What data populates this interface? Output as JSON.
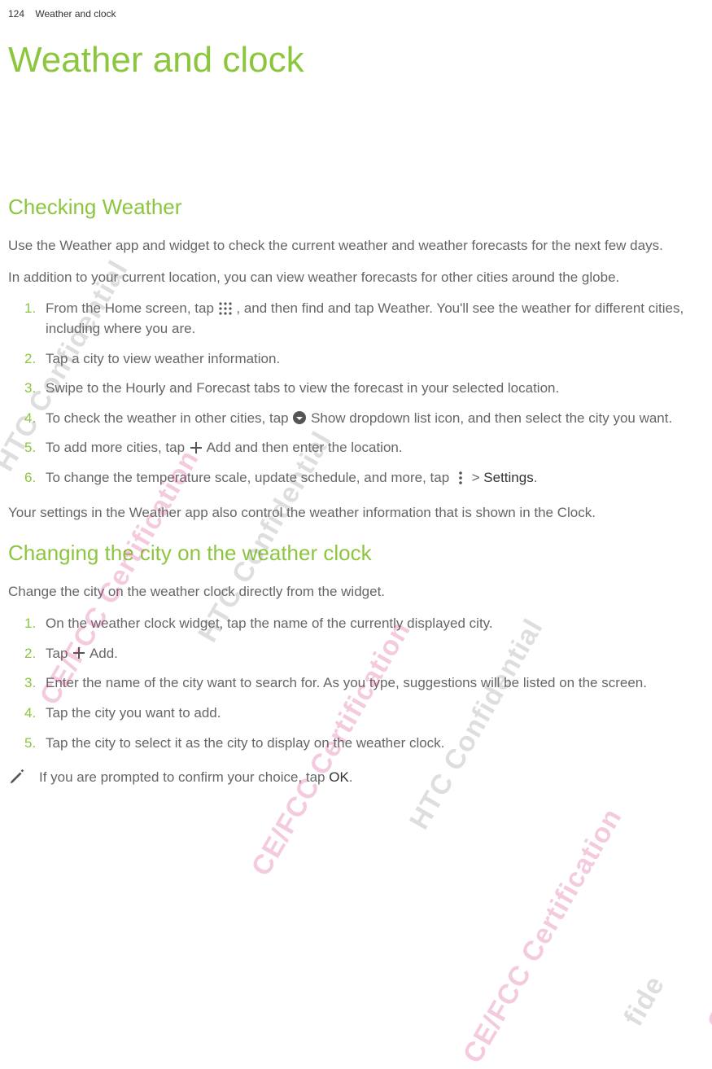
{
  "header": {
    "page_number": "124",
    "running_title": "Weather and clock"
  },
  "title": "Weather and clock",
  "section1": {
    "heading": "Checking Weather",
    "para1": "Use the Weather app and widget to check the current weather and weather forecasts for the next few days.",
    "para2": " In addition to your current location, you can view weather forecasts for other cities around the globe.",
    "steps": {
      "s1a": " From the Home screen, tap ",
      "s1b": ", and then find and tap Weather. You'll see the weather for different cities, including where you are.",
      "s2": "Tap a city to view weather information.",
      "s3": "Swipe to the Hourly and Forecast  tabs to view the forecast in your selected location.",
      "s4a": "To check the weather in other cities, tap ",
      "s4b": "Show dropdown list icon, and then select the city you want.",
      "s5a": "To add more cities, tap ",
      "s5b": "Add and then enter the location.",
      "s6a": "To change the temperature scale, update schedule, and more, tap ",
      "s6b": " > ",
      "s6c": "Settings",
      "s6d": "."
    },
    "para3": " Your settings in the Weather app also control the weather information that is shown in the Clock."
  },
  "section2": {
    "heading": "Changing the city on the weather clock",
    "para1": "Change the city on the weather clock directly from the widget.",
    "steps": {
      "s1": "On the weather clock widget, tap the name of the currently displayed city.",
      "s2a": "Tap ",
      "s2b": "Add.",
      "s3": "Enter the name of the city want to search for. As you type, suggestions will be listed on the screen.",
      "s4": "Tap the city you want to add.",
      "s5": "Tap the city to select it as the city to display on the weather clock."
    },
    "note_a": "If you are prompted to confirm your choice, tap ",
    "note_b": "OK",
    "note_c": "."
  },
  "watermarks": {
    "conf": "HTC  Confidential",
    "cert": "CE/FCC Certification",
    "short_cation": "cation",
    "short_fide": "fide"
  },
  "icons": {
    "grid": "apps-grid-icon",
    "dropdown": "dropdown-icon",
    "plus": "plus-icon",
    "more": "more-vertical-icon",
    "pencil": "pencil-note-icon"
  }
}
